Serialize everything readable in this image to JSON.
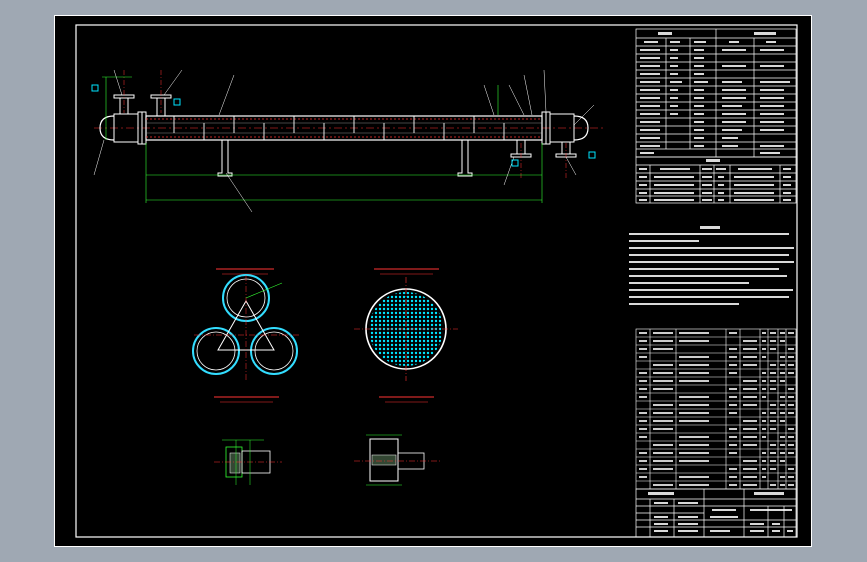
{
  "colors": {
    "background": "#9fa8b3",
    "sheet": "#000000",
    "frame": "#ffffff",
    "centerline": "#ff3333",
    "dimension": "#33ff33",
    "tubesheet": "#00e5ff",
    "note": "#ffff66"
  }
}
